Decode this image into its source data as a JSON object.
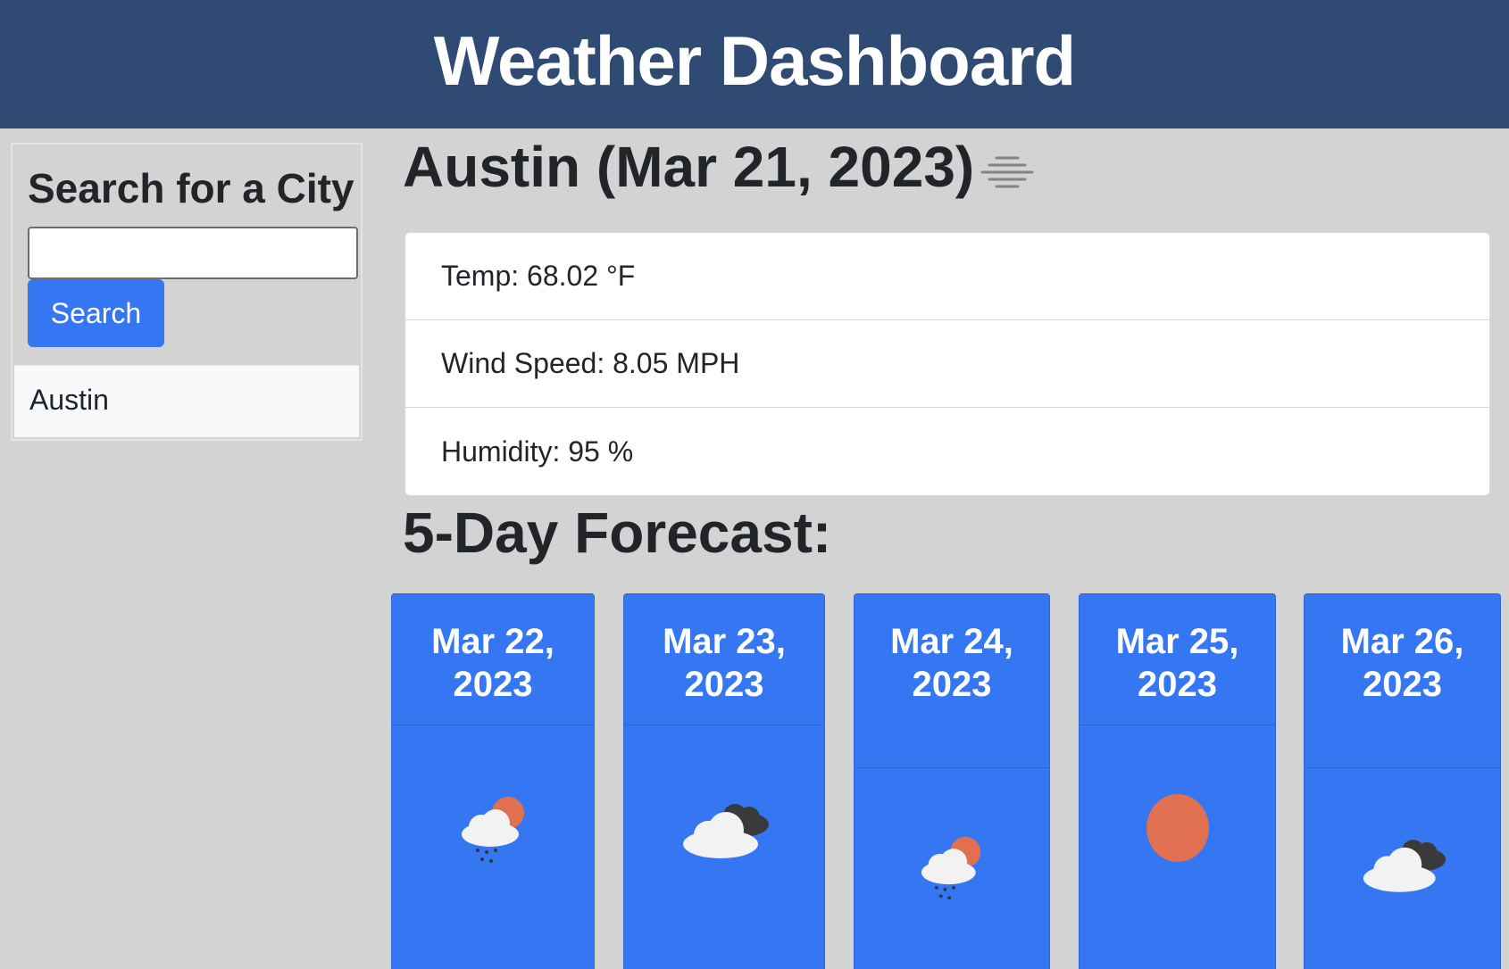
{
  "header": {
    "title": "Weather Dashboard"
  },
  "sidebar": {
    "heading": "Search for a City",
    "search_value": "",
    "search_button": "Search",
    "history": [
      "Austin"
    ]
  },
  "current": {
    "title": "Austin (Mar 21, 2023)",
    "icon": "mist-icon",
    "temp": "Temp: 68.02 °F",
    "wind": "Wind Speed: 8.05 MPH",
    "humidity": "Humidity: 95 %"
  },
  "forecast": {
    "title": "5-Day Forecast:",
    "days": [
      {
        "date": "Mar 22, 2023",
        "icon": "rain-sun-icon"
      },
      {
        "date": "Mar 23, 2023",
        "icon": "broken-clouds-icon"
      },
      {
        "date": "Mar 24, 2023",
        "icon": "rain-sun-icon"
      },
      {
        "date": "Mar 25, 2023",
        "icon": "sun-icon"
      },
      {
        "date": "Mar 26, 2023",
        "icon": "broken-clouds-icon"
      }
    ]
  },
  "colors": {
    "header_bg": "#304b73",
    "page_bg": "#d3d3d3",
    "accent_blue": "#3577f2",
    "sun_orange": "#e07050"
  }
}
